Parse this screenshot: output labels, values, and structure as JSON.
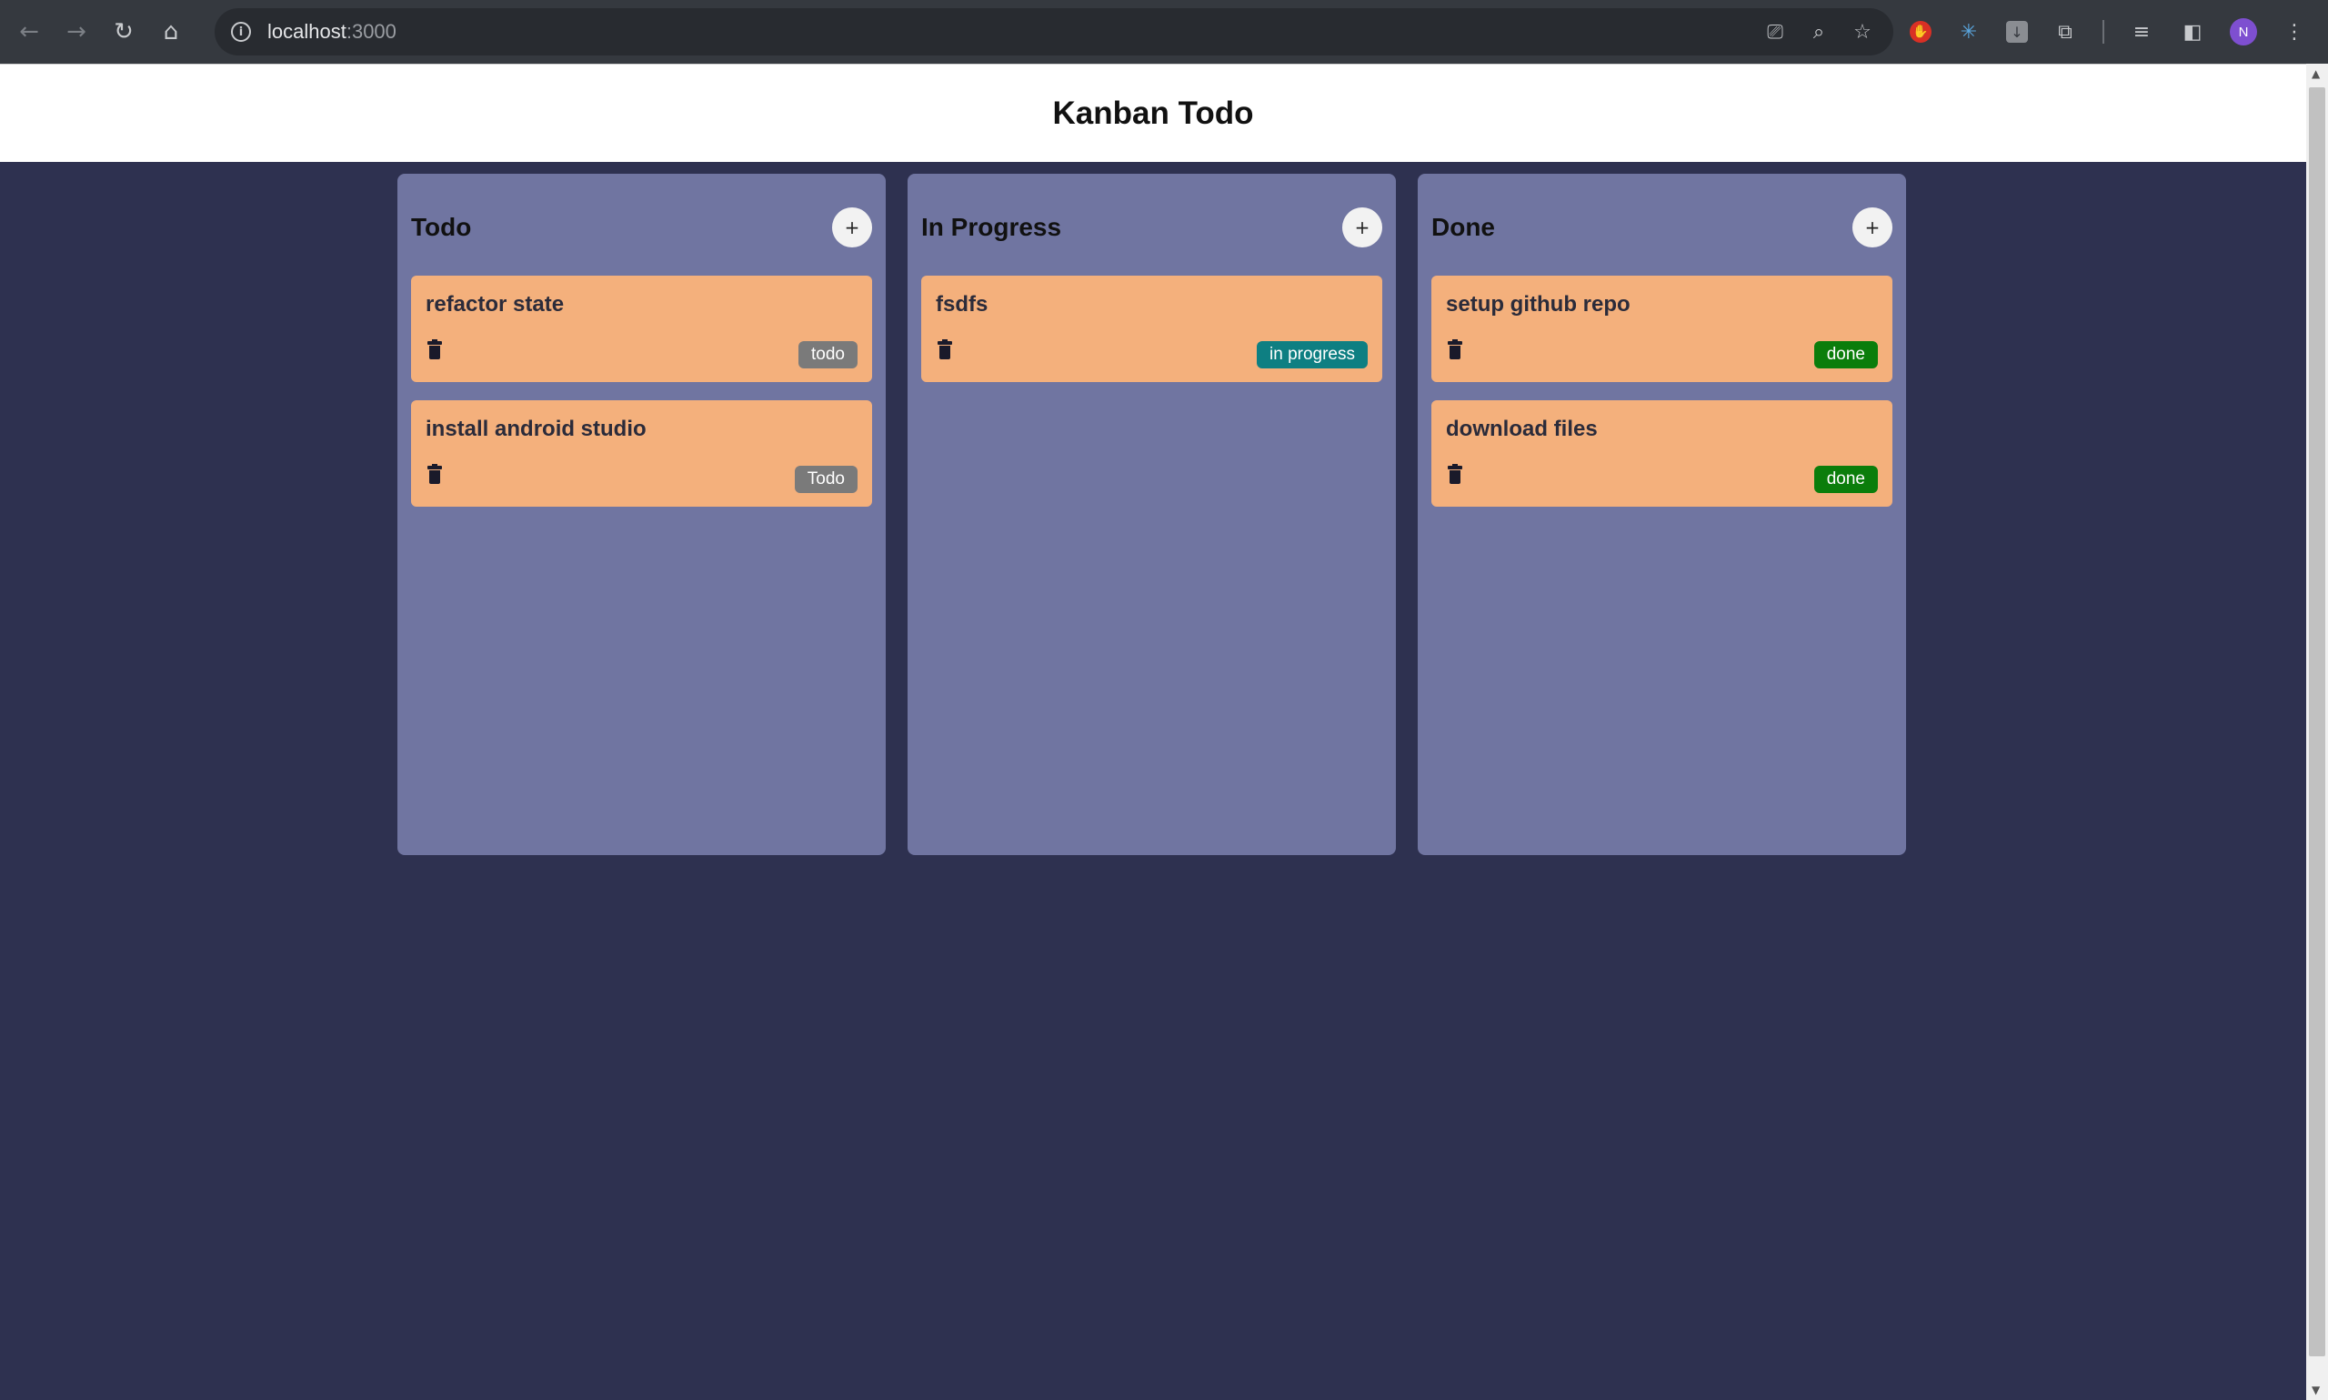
{
  "browser": {
    "url_host": "localhost",
    "url_port": ":3000",
    "avatar_letter": "N"
  },
  "app": {
    "title": "Kanban Todo"
  },
  "columns": [
    {
      "title": "Todo",
      "add_label": "+",
      "cards": [
        {
          "title": "refactor state",
          "status": "todo"
        },
        {
          "title": "install android studio",
          "status": "Todo"
        }
      ]
    },
    {
      "title": "In Progress",
      "add_label": "+",
      "cards": [
        {
          "title": "fsdfs",
          "status": "in progress"
        }
      ]
    },
    {
      "title": "Done",
      "add_label": "+",
      "cards": [
        {
          "title": "setup github repo",
          "status": "done"
        },
        {
          "title": "download files",
          "status": "done"
        }
      ]
    }
  ],
  "colors": {
    "page_background": "#2e3150",
    "column_background": "#7075a1",
    "card_background": "#f4b07c",
    "badge_todo": "#7a7a7a",
    "badge_in_progress": "#0e7f82",
    "badge_done": "#0b7d0b"
  }
}
